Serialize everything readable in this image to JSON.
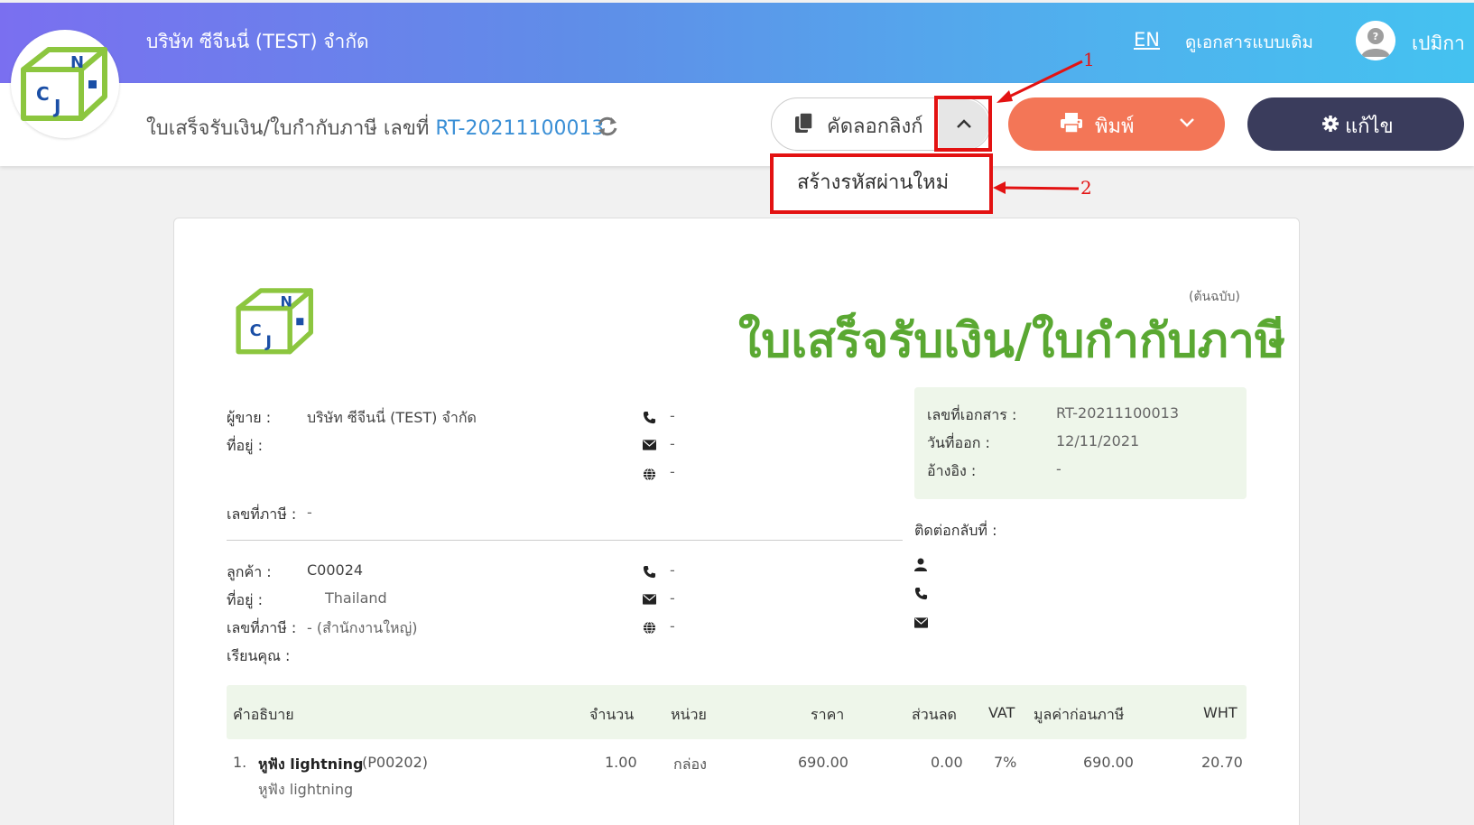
{
  "header": {
    "company": "บริษัท ซีจีนนี่ (TEST) จำกัด",
    "lang": "EN",
    "old_view": "ดูเอกสารแบบเดิม",
    "user": "เปมิกา"
  },
  "subbar": {
    "doc_title_prefix": "ใบเสร็จรับเงิน/ใบกำกับภาษี เลขที่",
    "doc_no": "RT-20211100013",
    "copy_link_label": "คัดลอกลิงก์",
    "regen_password_label": "สร้างรหัสผ่านใหม่",
    "print_label": "พิมพ์",
    "edit_label": "แก้ไข"
  },
  "annotations": {
    "one": "1",
    "two": "2"
  },
  "doc": {
    "original_label": "(ต้นฉบับ)",
    "title": "ใบเสร็จรับเงิน/ใบกำกับภาษี",
    "seller": {
      "seller_label": "ผู้ขาย :",
      "seller_value": "บริษัท ซีจีนนี่ (TEST) จำกัด",
      "address_label": "ที่อยู่ :",
      "tax_label": "เลขที่ภาษี :",
      "tax_value": "-",
      "phone": "-",
      "email": "-",
      "web": "-"
    },
    "info": {
      "docno_label": "เลขที่เอกสาร :",
      "docno_value": "RT-20211100013",
      "date_label": "วันที่ออก :",
      "date_value": "12/11/2021",
      "ref_label": "อ้างอิง :",
      "ref_value": "-"
    },
    "contact_label": "ติดต่อกลับที่ :",
    "customer": {
      "customer_label": "ลูกค้า :",
      "customer_value": "C00024",
      "address_label": "ที่อยู่ :",
      "address_value": "Thailand",
      "tax_label": "เลขที่ภาษี :",
      "tax_value": "- (สำนักงานใหญ่)",
      "attn_label": "เรียนคุณ :",
      "phone": "-",
      "email": "-",
      "web": "-"
    },
    "table": {
      "headers": [
        "คำอธิบาย",
        "จำนวน",
        "หน่วย",
        "ราคา",
        "ส่วนลด",
        "VAT",
        "มูลค่าก่อนภาษี",
        "WHT"
      ],
      "rows": [
        {
          "no": "1.",
          "name": "หูฟัง lightning",
          "code": "(P00202)",
          "desc": "หูฟัง lightning",
          "qty": "1.00",
          "unit": "กล่อง",
          "price": "690.00",
          "discount": "0.00",
          "vat": "7%",
          "pretax": "690.00",
          "wht": "20.70"
        }
      ]
    }
  },
  "colors": {
    "accent_green": "#5aa832",
    "print_orange": "#f37657",
    "edit_navy": "#3a3c5c",
    "link_blue": "#3a8fd6",
    "annotation_red": "#e31212"
  }
}
